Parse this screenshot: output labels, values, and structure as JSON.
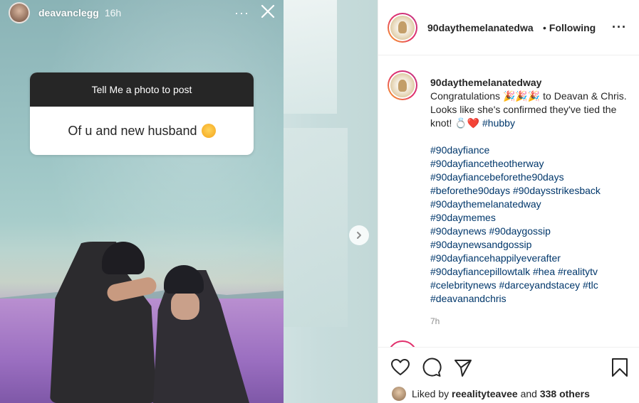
{
  "story": {
    "username": "deavanclegg",
    "time": "16h",
    "more_label": "···",
    "question": "Tell Me a photo to post",
    "answer": "Of u and new husband"
  },
  "post": {
    "username": "90daythemelanatedwa",
    "dot": "•",
    "follow_label": "Following",
    "more_label": "···"
  },
  "caption": {
    "username": "90daythemelanatedway",
    "text_1": "Congratulations",
    "text_2": "to Deavan & Chris. Looks like she's confirmed they've tied the knot!",
    "hashtag_inline": "#hubby",
    "hashtags": [
      "#90dayfiance",
      "#90dayfiancetheotherway",
      "#90dayfiancebeforethe90days",
      "#beforethe90days #90daysstrikesback",
      "#90daythemelanatedway",
      "#90daymemes",
      "#90daynews #90daygossip",
      "#90daynewsandgossip",
      "#90dayfiancehappilyeverafter",
      "#90dayfiancepillowtalk #hea #realitytv",
      "#celebritynews #darceyandstacey #tlc",
      "#deavanandchris"
    ],
    "time": "7h"
  },
  "likes": {
    "prefix": "Liked by",
    "user": "reealityteavee",
    "middle": "and",
    "count": "338 others"
  },
  "icons": [
    "close-icon",
    "chevron-right-icon",
    "heart-icon",
    "comment-icon",
    "share-icon",
    "bookmark-icon"
  ],
  "colors": {
    "hashtag": "#00376b",
    "text": "#262626",
    "muted": "#8e8e8e"
  }
}
